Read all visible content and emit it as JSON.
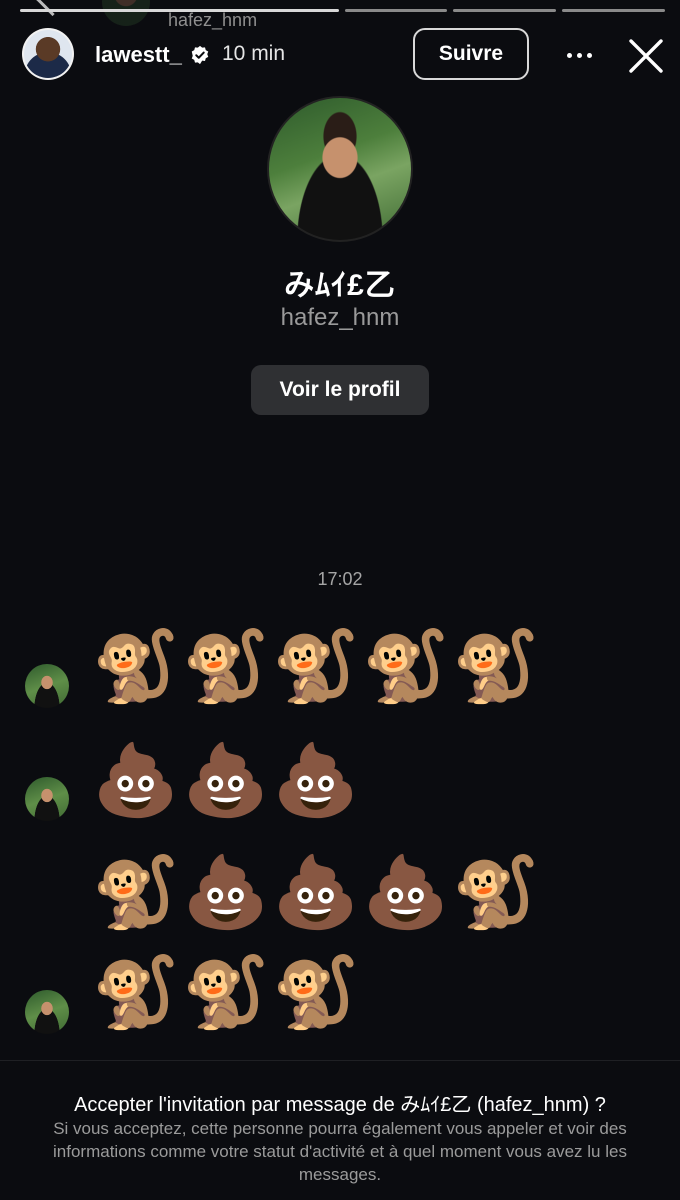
{
  "peek": {
    "username": "hafez_hnm"
  },
  "story_header": {
    "username": "lawestt_",
    "verified": true,
    "time": "10 min",
    "follow_label": "Suivre",
    "more_icon": "more-horizontal-icon",
    "close_icon": "close-icon"
  },
  "profile": {
    "display_name": "みﾑｲ£乙",
    "username": "hafez_hnm",
    "view_profile_label": "Voir le profil"
  },
  "conversation": {
    "timestamp": "17:02",
    "messages": [
      {
        "emojis": [
          "🐒",
          "🐒",
          "🐒",
          "🐒",
          "🐒"
        ],
        "avatar": true
      },
      {
        "emojis": [
          "💩",
          "💩",
          "💩"
        ],
        "avatar": true
      },
      {
        "emojis": [
          "🐒",
          "💩",
          "💩",
          "💩",
          "🐒"
        ],
        "avatar": false
      },
      {
        "emojis": [
          "🐒",
          "🐒",
          "🐒"
        ],
        "avatar": true
      }
    ]
  },
  "invitation": {
    "title": "Accepter l'invitation par message de みﾑｲ£乙 (hafez_hnm) ?",
    "body": "Si vous acceptez, cette personne pourra également vous appeler et voir des informations comme votre statut d'activité et à quel moment vous avez lu les messages."
  },
  "colors": {
    "background": "#0b0c10",
    "button_bg": "#2f3033",
    "verified_blue": "#ffffff"
  }
}
